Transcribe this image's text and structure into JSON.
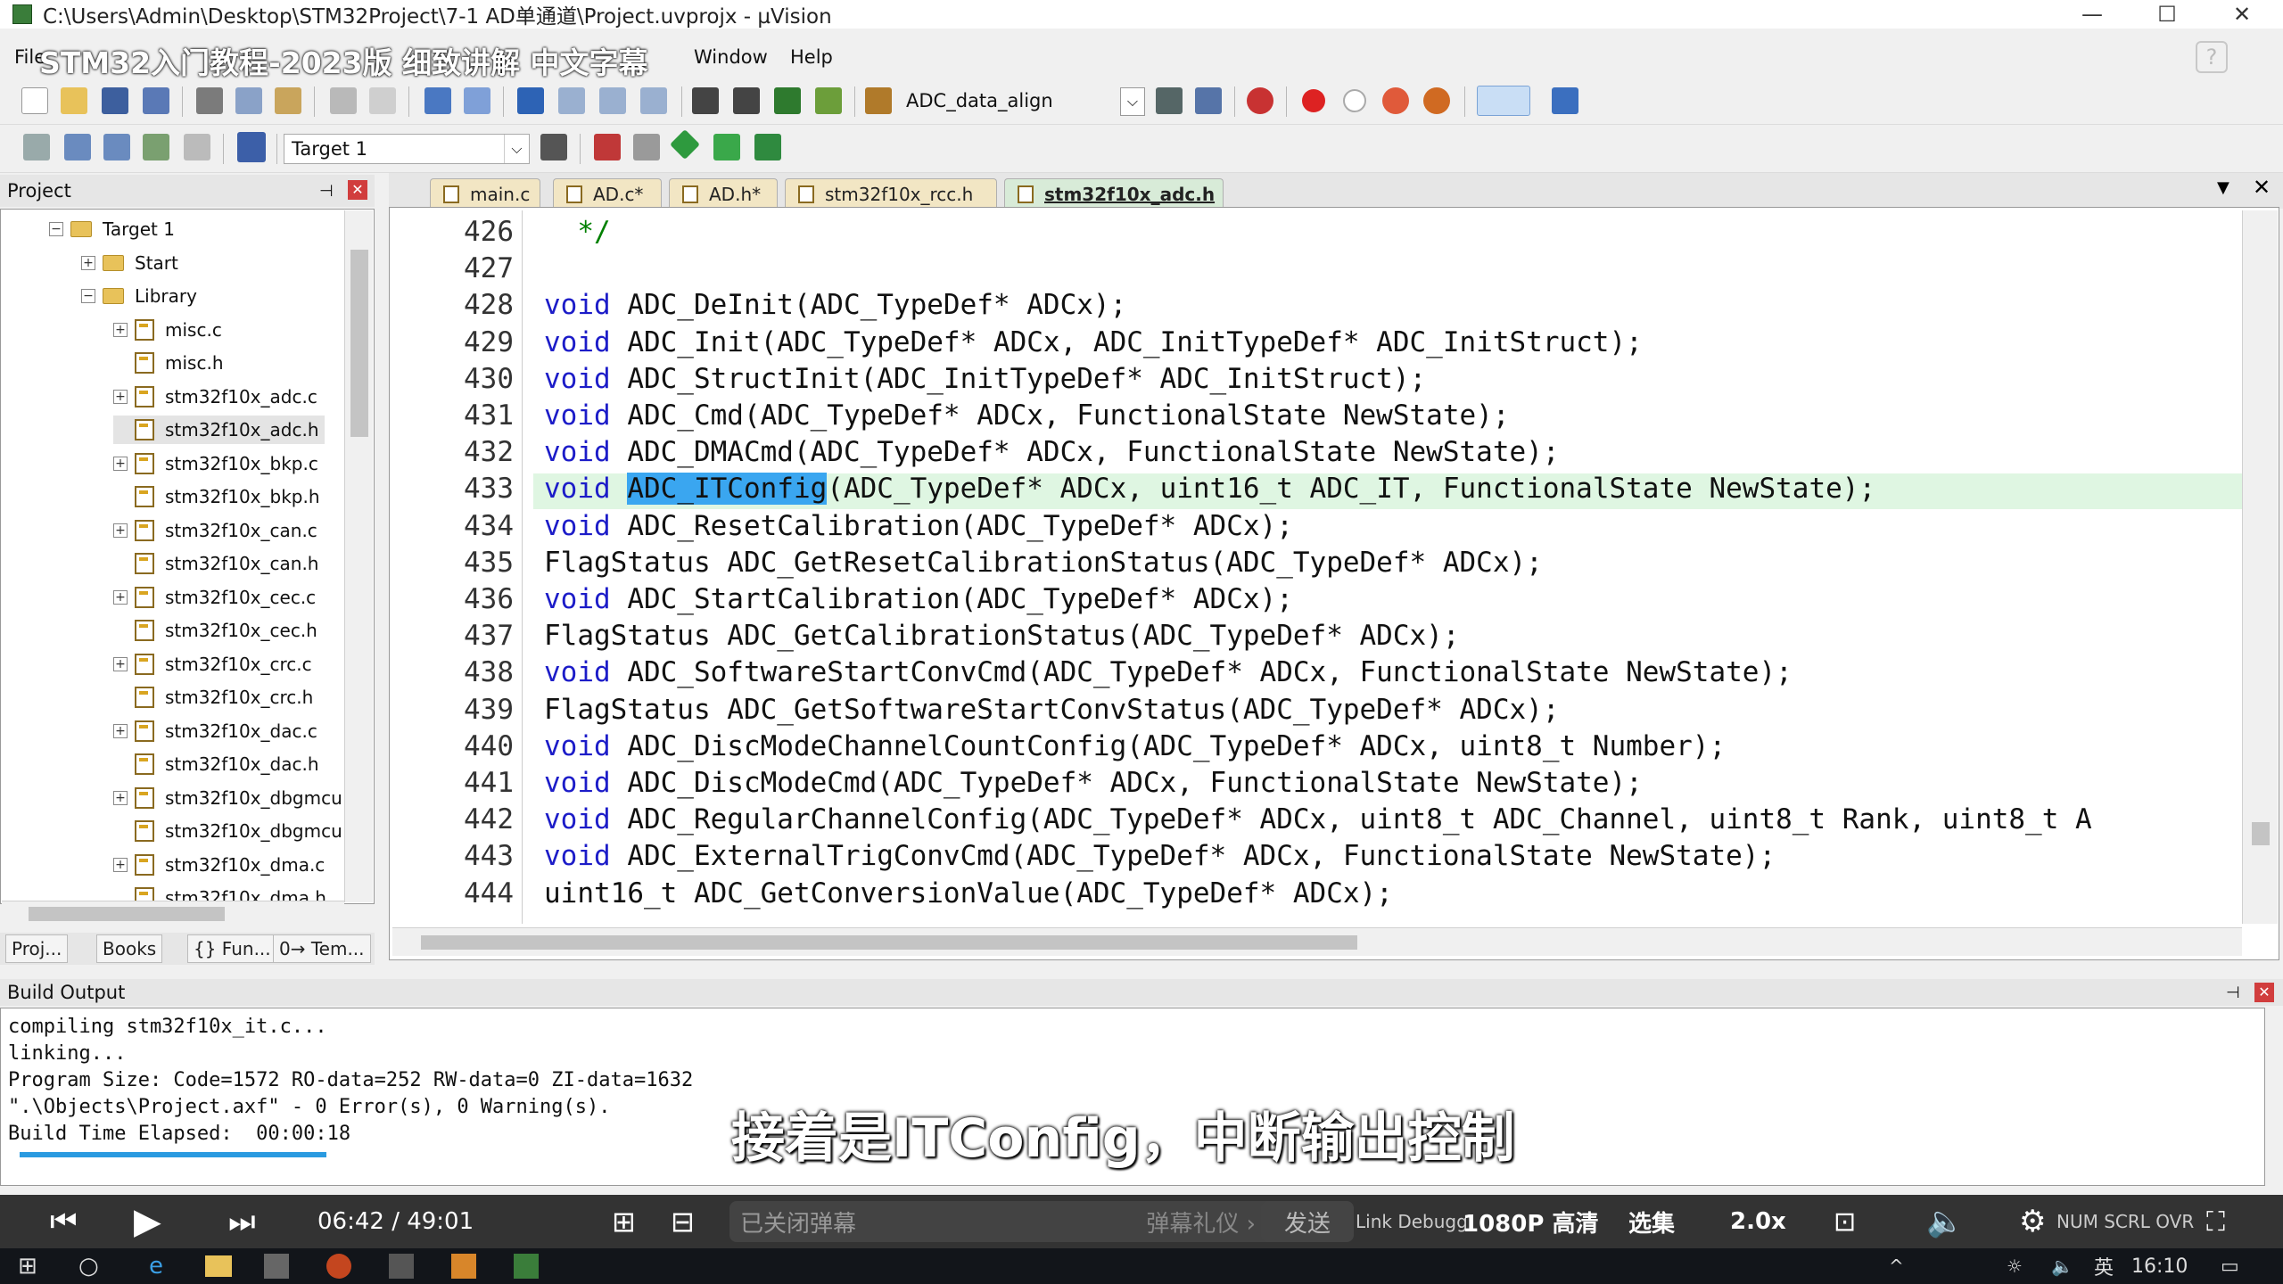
{
  "window": {
    "title": "C:\\Users\\Admin\\Desktop\\STM32Project\\7-1 AD单通道\\Project.uvprojx - µVision"
  },
  "overlay_title": "STM32入门教程-2023版 细致讲解 中文字幕",
  "menu": {
    "file": "File",
    "window": "Window",
    "help": "Help"
  },
  "toolbar": {
    "function_combo": "ADC_data_align",
    "target_combo": "Target 1"
  },
  "project_panel": {
    "title": "Project",
    "tree": [
      {
        "label": "Target 1",
        "level": 0,
        "kind": "folder",
        "expander": "−"
      },
      {
        "label": "Start",
        "level": 1,
        "kind": "folder",
        "expander": "+"
      },
      {
        "label": "Library",
        "level": 1,
        "kind": "folder",
        "expander": "−"
      },
      {
        "label": "misc.c",
        "level": 2,
        "kind": "file",
        "expander": "+"
      },
      {
        "label": "misc.h",
        "level": 2,
        "kind": "file",
        "expander": ""
      },
      {
        "label": "stm32f10x_adc.c",
        "level": 2,
        "kind": "file",
        "expander": "+"
      },
      {
        "label": "stm32f10x_adc.h",
        "level": 2,
        "kind": "file",
        "expander": "",
        "selected": true
      },
      {
        "label": "stm32f10x_bkp.c",
        "level": 2,
        "kind": "file",
        "expander": "+"
      },
      {
        "label": "stm32f10x_bkp.h",
        "level": 2,
        "kind": "file",
        "expander": ""
      },
      {
        "label": "stm32f10x_can.c",
        "level": 2,
        "kind": "file",
        "expander": "+"
      },
      {
        "label": "stm32f10x_can.h",
        "level": 2,
        "kind": "file",
        "expander": ""
      },
      {
        "label": "stm32f10x_cec.c",
        "level": 2,
        "kind": "file",
        "expander": "+"
      },
      {
        "label": "stm32f10x_cec.h",
        "level": 2,
        "kind": "file",
        "expander": ""
      },
      {
        "label": "stm32f10x_crc.c",
        "level": 2,
        "kind": "file",
        "expander": "+"
      },
      {
        "label": "stm32f10x_crc.h",
        "level": 2,
        "kind": "file",
        "expander": ""
      },
      {
        "label": "stm32f10x_dac.c",
        "level": 2,
        "kind": "file",
        "expander": "+"
      },
      {
        "label": "stm32f10x_dac.h",
        "level": 2,
        "kind": "file",
        "expander": ""
      },
      {
        "label": "stm32f10x_dbgmcu",
        "level": 2,
        "kind": "file",
        "expander": "+"
      },
      {
        "label": "stm32f10x_dbgmcu",
        "level": 2,
        "kind": "file",
        "expander": ""
      },
      {
        "label": "stm32f10x_dma.c",
        "level": 2,
        "kind": "file",
        "expander": "+"
      },
      {
        "label": "stm32f10x_dma.h",
        "level": 2,
        "kind": "file",
        "expander": ""
      }
    ],
    "bottom_tabs": [
      "Proj...",
      "Books",
      "{} Fun...",
      "0→ Tem..."
    ]
  },
  "editor": {
    "tabs": [
      {
        "label": "main.c",
        "active": false
      },
      {
        "label": "AD.c*",
        "active": false
      },
      {
        "label": "AD.h*",
        "active": false
      },
      {
        "label": "stm32f10x_rcc.h",
        "active": false
      },
      {
        "label": "stm32f10x_adc.h",
        "active": true
      }
    ],
    "lines": [
      {
        "n": "426",
        "code": "  */",
        "type": "comment"
      },
      {
        "n": "427",
        "code": "",
        "type": "plain"
      },
      {
        "n": "428",
        "kw": "void",
        "rest": " ADC_DeInit(ADC_TypeDef* ADCx);"
      },
      {
        "n": "429",
        "kw": "void",
        "rest": " ADC_Init(ADC_TypeDef* ADCx, ADC_InitTypeDef* ADC_InitStruct);"
      },
      {
        "n": "430",
        "kw": "void",
        "rest": " ADC_StructInit(ADC_InitTypeDef* ADC_InitStruct);"
      },
      {
        "n": "431",
        "kw": "void",
        "rest": " ADC_Cmd(ADC_TypeDef* ADCx, FunctionalState NewState);"
      },
      {
        "n": "432",
        "kw": "void",
        "rest": " ADC_DMACmd(ADC_TypeDef* ADCx, FunctionalState NewState);"
      },
      {
        "n": "433",
        "kw": "void",
        "sel": "ADC_ITConfig",
        "rest": "(ADC_TypeDef* ADCx, uint16_t ADC_IT, FunctionalState NewState",
        "tail": ");",
        "highlight": true
      },
      {
        "n": "434",
        "kw": "void",
        "rest": " ADC_ResetCalibration(ADC_TypeDef* ADCx);"
      },
      {
        "n": "435",
        "kw": "",
        "rest": "FlagStatus ADC_GetResetCalibrationStatus(ADC_TypeDef* ADCx);"
      },
      {
        "n": "436",
        "kw": "void",
        "rest": " ADC_StartCalibration(ADC_TypeDef* ADCx);"
      },
      {
        "n": "437",
        "kw": "",
        "rest": "FlagStatus ADC_GetCalibrationStatus(ADC_TypeDef* ADCx);"
      },
      {
        "n": "438",
        "kw": "void",
        "rest": " ADC_SoftwareStartConvCmd(ADC_TypeDef* ADCx, FunctionalState NewState);"
      },
      {
        "n": "439",
        "kw": "",
        "rest": "FlagStatus ADC_GetSoftwareStartConvStatus(ADC_TypeDef* ADCx);"
      },
      {
        "n": "440",
        "kw": "void",
        "rest": " ADC_DiscModeChannelCountConfig(ADC_TypeDef* ADCx, uint8_t Number);"
      },
      {
        "n": "441",
        "kw": "void",
        "rest": " ADC_DiscModeCmd(ADC_TypeDef* ADCx, FunctionalState NewState);"
      },
      {
        "n": "442",
        "kw": "void",
        "rest": " ADC_RegularChannelConfig(ADC_TypeDef* ADCx, uint8_t ADC_Channel, uint8_t Rank, uint8_t A"
      },
      {
        "n": "443",
        "kw": "void",
        "rest": " ADC_ExternalTrigConvCmd(ADC_TypeDef* ADCx, FunctionalState NewState);"
      },
      {
        "n": "444",
        "kw": "",
        "rest": "uint16_t ADC_GetConversionValue(ADC_TypeDef* ADCx);"
      }
    ]
  },
  "build_output": {
    "title": "Build Output",
    "lines": [
      "compiling stm32f10x_it.c...",
      "linking...",
      "Program Size: Code=1572 RO-data=252 RW-data=0 ZI-data=1632",
      "\".\\Objects\\Project.axf\" - 0 Error(s), 0 Warning(s).",
      "Build Time Elapsed:  00:00:18"
    ]
  },
  "subtitle": "接着是ITConfig，中断输出控制",
  "player": {
    "time": "06:42 / 49:01",
    "danmaku_placeholder": "已关闭弹幕",
    "danmaku_gift": "弹幕礼仪 ›",
    "send": "发送",
    "quality": "1080P 高清",
    "episodes": "选集",
    "speed": "2.0x",
    "status_left": "Link Debugg",
    "status_right": "NUM  SCRL  OVR"
  },
  "taskbar": {
    "ime": "英",
    "clock": "16:10"
  }
}
